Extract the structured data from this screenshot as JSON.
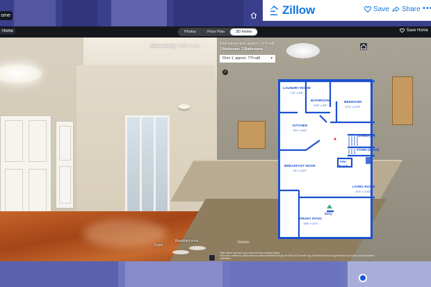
{
  "header": {
    "home_chip": "ome",
    "brand": "Zillow",
    "save_label": "Save",
    "share_label": "Share",
    "more_label": "•••"
  },
  "toolbar": {
    "home_label": "Home",
    "tabs": [
      {
        "label": "Photos",
        "active": false
      },
      {
        "label": "Floor Plan",
        "active": false
      },
      {
        "label": "3D Home",
        "active": true
      }
    ],
    "save_home_label": "Save Home"
  },
  "viewer": {
    "room_name": "Stair landing",
    "views": "• 1344 views",
    "total_size": "Total interior size: approx. 1978 sqft.",
    "bed_bath_beds": "3 Bedrooms",
    "bed_bath_baths": "3 Bathrooms",
    "floor_select": "Floor 1, approx. 779 sqft",
    "kitchen_caption": "Kitchen",
    "footnote_line1": "Total interior size and room sizes are from property listing.",
    "footnote_line2": "Floor plan created by Zillow based on data submitted through the Zillow 3D Home® app. All dimensions are approximate and subject to independent verification.",
    "hotspots": [
      {
        "label": "Breakfast nook"
      },
      {
        "label": "Foyer"
      }
    ]
  },
  "floorplan": {
    "rooms": [
      {
        "name": "LAUNDRY ROOM",
        "dim": "7'11\" x 5'6\""
      },
      {
        "name": "BATHROOM",
        "dim": "4'10\" x 6'8\""
      },
      {
        "name": "BEDROOM",
        "dim": "12'4\" x 10'3\""
      },
      {
        "name": "KITCHEN",
        "dim": "9'9\" x 10'5\""
      },
      {
        "name": "STAIRS (UP)",
        "dim": ""
      },
      {
        "name": "STAIRS (DOWN)",
        "dim": ""
      },
      {
        "name": "FIRE-PLACE",
        "dim": ""
      },
      {
        "name": "BREAKFAST NOOK",
        "dim": "9'1\" x 10'1\""
      },
      {
        "name": "LIVING ROOM",
        "dim": "12'4\" x 13'11\""
      },
      {
        "name": "FRONT PATIO",
        "dim": "13'6\" x 11'1\""
      },
      {
        "name": "Entry",
        "dim": ""
      }
    ],
    "accent_color": "#1a4fd0"
  },
  "colors": {
    "zillow_blue": "#1277e1",
    "plan_blue": "#1a4fd0"
  }
}
